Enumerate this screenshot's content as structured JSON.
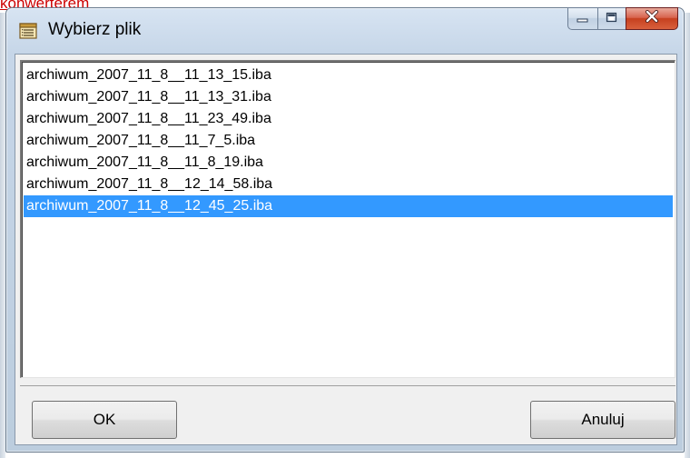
{
  "background": {
    "link_text": "konwerterem"
  },
  "window": {
    "title": "Wybierz plik",
    "title_icon": "file-list-icon",
    "caption_buttons": {
      "minimize_icon": "minimize-icon",
      "maximize_icon": "maximize-icon",
      "close_icon": "close-icon"
    }
  },
  "file_list": {
    "items": [
      "archiwum_2007_11_8__11_13_15.iba",
      "archiwum_2007_11_8__11_13_31.iba",
      "archiwum_2007_11_8__11_23_49.iba",
      "archiwum_2007_11_8__11_7_5.iba",
      "archiwum_2007_11_8__11_8_19.iba",
      "archiwum_2007_11_8__12_14_58.iba",
      "archiwum_2007_11_8__12_45_25.iba"
    ],
    "selected_index": 6
  },
  "buttons": {
    "ok_label": "OK",
    "cancel_label": "Anuluj"
  },
  "colors": {
    "selection": "#3399ff",
    "selection_text": "#ffffff",
    "close_button": "#c6401f",
    "link": "#cc0000"
  }
}
